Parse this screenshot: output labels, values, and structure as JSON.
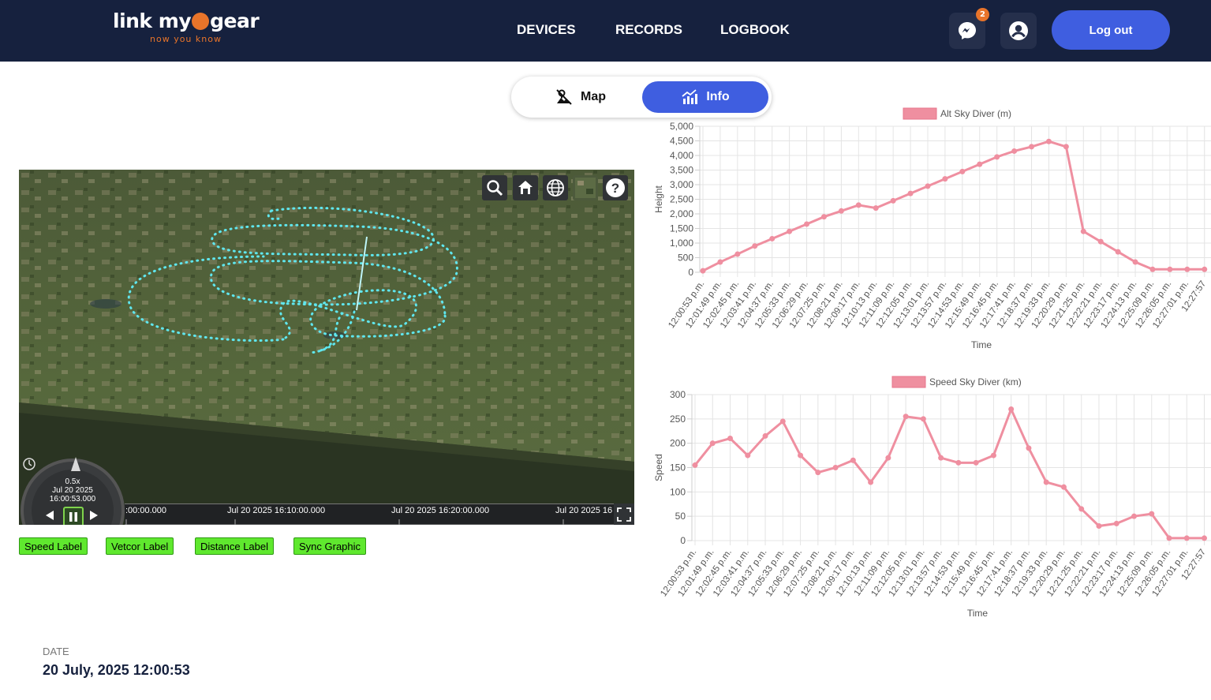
{
  "header": {
    "logo_text_left": "link my",
    "logo_text_right": "gear",
    "tagline": "now you know",
    "nav": [
      "DEVICES",
      "RECORDS",
      "LOGBOOK"
    ],
    "messages_badge": "2",
    "logout_label": "Log out"
  },
  "view_toggle": {
    "map_label": "Map",
    "info_label": "Info",
    "active": "Info"
  },
  "map": {
    "timeline": {
      "speed": "0.5x",
      "date": "Jul 20 2025",
      "time": "16:00:53.000",
      "ticks": [
        ":00:00.000",
        "Jul 20 2025 16:10:00.000",
        "Jul 20 2025 16:20:00.000",
        "Jul 20 2025 16"
      ]
    }
  },
  "label_buttons": [
    "Speed Label",
    "Vetcor Label",
    "Distance Label",
    "Sync Graphic"
  ],
  "date_section": {
    "label": "DATE",
    "value": "20 July, 2025 12:00:53"
  },
  "colors": {
    "header_bg": "#16213e",
    "accent": "#3f5ee0",
    "brand_orange": "#e8742a",
    "series": "#ef8fa0",
    "track": "#5fe6ee",
    "label_btn": "#5fe82e"
  },
  "chart_data": [
    {
      "type": "line",
      "legend": "Alt Sky Diver (m)",
      "xlabel": "Time",
      "ylabel": "Height",
      "ylim": [
        0,
        5000
      ],
      "yticks": [
        "5,000",
        "4,500",
        "4,000",
        "3,500",
        "3,000",
        "2,500",
        "2,000",
        "1,500",
        "1,000",
        "500",
        "0"
      ],
      "categories": [
        "12:00:53 p.m.",
        "12:01:49 p.m.",
        "12:02:45 p.m.",
        "12:03:41 p.m.",
        "12:04:37 p.m.",
        "12:05:33 p.m.",
        "12:06:29 p.m.",
        "12:07:25 p.m.",
        "12:08:21 p.m.",
        "12:09:17 p.m.",
        "12:10:13 p.m.",
        "12:11:09 p.m.",
        "12:12:05 p.m.",
        "12:13:01 p.m.",
        "12:13:57 p.m.",
        "12:14:53 p.m.",
        "12:15:49 p.m.",
        "12:16:45 p.m.",
        "12:17:41 p.m.",
        "12:18:37 p.m.",
        "12:19:33 p.m.",
        "12:20:29 p.m.",
        "12:21:25 p.m.",
        "12:22:21 p.m.",
        "12:23:17 p.m.",
        "12:24:13 p.m.",
        "12:25:09 p.m.",
        "12:26:05 p.m.",
        "12:27:01 p.m.",
        "12:27:57"
      ],
      "values": [
        50,
        350,
        620,
        900,
        1150,
        1400,
        1650,
        1900,
        2100,
        2300,
        2200,
        2450,
        2700,
        2950,
        3200,
        3450,
        3700,
        3950,
        4150,
        4300,
        4480,
        4300,
        1400,
        1050,
        700,
        350,
        100,
        100,
        100,
        100
      ]
    },
    {
      "type": "line",
      "legend": "Speed Sky Diver (km)",
      "xlabel": "Time",
      "ylabel": "Speed",
      "ylim": [
        0,
        300
      ],
      "yticks": [
        "300",
        "250",
        "200",
        "150",
        "100",
        "50",
        "0"
      ],
      "categories": [
        "12:00:53 p.m.",
        "12:01:49 p.m.",
        "12:02:45 p.m.",
        "12:03:41 p.m.",
        "12:04:37 p.m.",
        "12:05:33 p.m.",
        "12:06:29 p.m.",
        "12:07:25 p.m.",
        "12:08:21 p.m.",
        "12:09:17 p.m.",
        "12:10:13 p.m.",
        "12:11:09 p.m.",
        "12:12:05 p.m.",
        "12:13:01 p.m.",
        "12:13:57 p.m.",
        "12:14:53 p.m.",
        "12:15:49 p.m.",
        "12:16:45 p.m.",
        "12:17:41 p.m.",
        "12:18:37 p.m.",
        "12:19:33 p.m.",
        "12:20:29 p.m.",
        "12:21:25 p.m.",
        "12:22:21 p.m.",
        "12:23:17 p.m.",
        "12:24:13 p.m.",
        "12:25:09 p.m.",
        "12:26:05 p.m.",
        "12:27:01 p.m.",
        "12:27:57"
      ],
      "values": [
        155,
        200,
        210,
        175,
        215,
        245,
        175,
        140,
        150,
        165,
        120,
        170,
        255,
        250,
        170,
        160,
        160,
        175,
        270,
        190,
        120,
        110,
        65,
        30,
        35,
        50,
        55,
        5,
        5,
        5
      ]
    }
  ]
}
